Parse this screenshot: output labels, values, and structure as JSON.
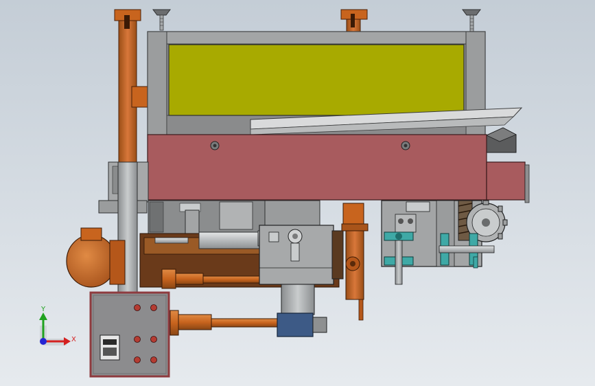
{
  "view": {
    "name": "cad-model-viewport",
    "background_top": "#c4cdd6",
    "background_bottom": "#e6eaee"
  },
  "colors": {
    "frame_gray": "#8f9091",
    "frame_dark": "#5a5b5c",
    "hopper_yellow": "#a8aa00",
    "beam_red": "#a85b5e",
    "copper": "#c8641e",
    "copper_dark": "#7a3a10",
    "steel_light": "#c9cccd",
    "steel_mid": "#a6a9ab",
    "teal_bearing": "#3fa9a6",
    "blue_gearbox": "#3d5a86",
    "panel_gray": "#8c8c8e",
    "panel_border": "#8e3b3f",
    "indicator_red": "#b43c32"
  },
  "triad": {
    "x_label": "X",
    "y_label": "Y",
    "z_label": "",
    "x_color": "#d42020",
    "y_color": "#1fa21f",
    "z_color": "#2424d4"
  },
  "parts": [
    "leveling-foot-left",
    "leveling-foot-right",
    "vertical-post-left",
    "vertical-post-mid",
    "hopper-frame",
    "feed-hopper",
    "inclined-chute",
    "main-crossbeam",
    "motor",
    "control-panel",
    "drive-shaft-upper",
    "drive-shaft-lower",
    "gear-housing",
    "gearbox-blue",
    "pillow-block-bearing",
    "sprocket-wheel",
    "worm-screw"
  ]
}
